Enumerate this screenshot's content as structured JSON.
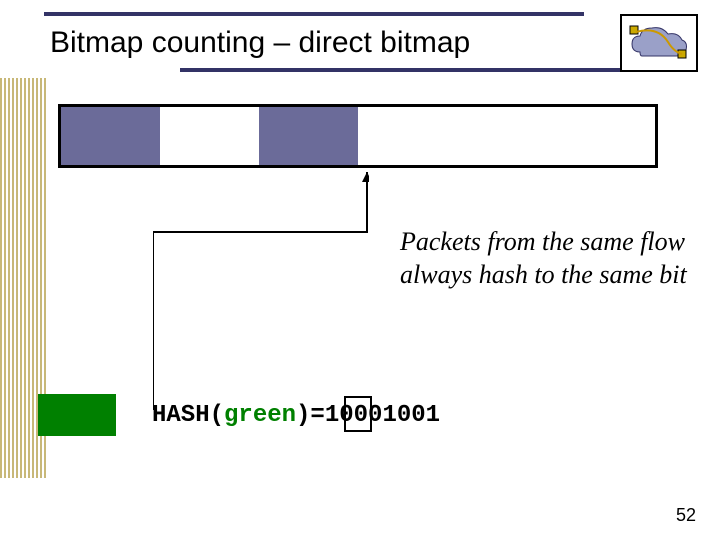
{
  "title": "Bitmap counting – direct bitmap",
  "bitmap": {
    "cells": [
      "filled",
      "empty",
      "filled",
      "empty",
      "empty",
      "empty"
    ]
  },
  "annotation": "Packets from the same flow always hash to the same bit",
  "hash": {
    "prefix": "HASH(",
    "arg": "green",
    "mid": ")=",
    "value": "10001001"
  },
  "page_number": "52"
}
